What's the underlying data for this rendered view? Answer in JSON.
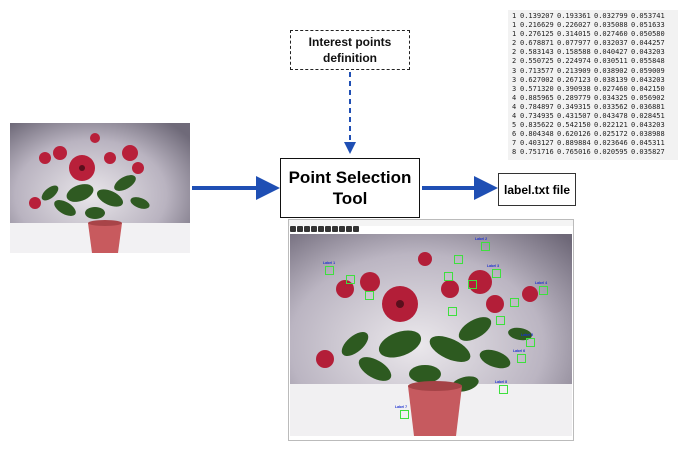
{
  "nodes": {
    "interest_line1": "Interest points",
    "interest_line2": "definition",
    "tool_line1": "Point Selection",
    "tool_line2": "Tool",
    "label_file": "label.txt file"
  },
  "table_rows": [
    [
      "1",
      "0.139207",
      "0.193361",
      "0.032799",
      "0.053741"
    ],
    [
      "1",
      "0.216629",
      "0.226027",
      "0.035088",
      "0.051633"
    ],
    [
      "1",
      "0.276125",
      "0.314015",
      "0.027460",
      "0.050580"
    ],
    [
      "2",
      "0.678871",
      "0.077977",
      "0.032037",
      "0.044257"
    ],
    [
      "2",
      "0.583143",
      "0.158588",
      "0.040427",
      "0.043203"
    ],
    [
      "2",
      "0.550725",
      "0.224974",
      "0.030511",
      "0.055848"
    ],
    [
      "3",
      "0.713577",
      "0.213909",
      "0.038902",
      "0.059009"
    ],
    [
      "3",
      "0.627002",
      "0.267123",
      "0.038139",
      "0.043203"
    ],
    [
      "3",
      "0.571320",
      "0.390938",
      "0.027460",
      "0.042150"
    ],
    [
      "4",
      "0.885965",
      "0.289779",
      "0.034325",
      "0.056902"
    ],
    [
      "4",
      "0.784897",
      "0.349315",
      "0.033562",
      "0.036881"
    ],
    [
      "4",
      "0.734935",
      "0.431507",
      "0.043478",
      "0.028451"
    ],
    [
      "5",
      "0.835622",
      "0.542150",
      "0.022121",
      "0.043203"
    ],
    [
      "6",
      "0.804348",
      "0.620126",
      "0.025172",
      "0.038988"
    ],
    [
      "7",
      "0.403127",
      "0.889884",
      "0.023646",
      "0.045311"
    ],
    [
      "8",
      "0.751716",
      "0.765016",
      "0.020595",
      "0.035827"
    ]
  ],
  "keypoint_labels": {
    "l1": "Label 1",
    "l2": "Label 2",
    "l3": "Label 3",
    "l4": "Label 4",
    "l5": "Label 5",
    "l6": "Label 6",
    "l7": "Label 7",
    "l8": "Label 8"
  },
  "colors": {
    "arrow": "#1f4fb4",
    "box_green": "#3ee03e",
    "label_blue": "#1a2fd0"
  }
}
